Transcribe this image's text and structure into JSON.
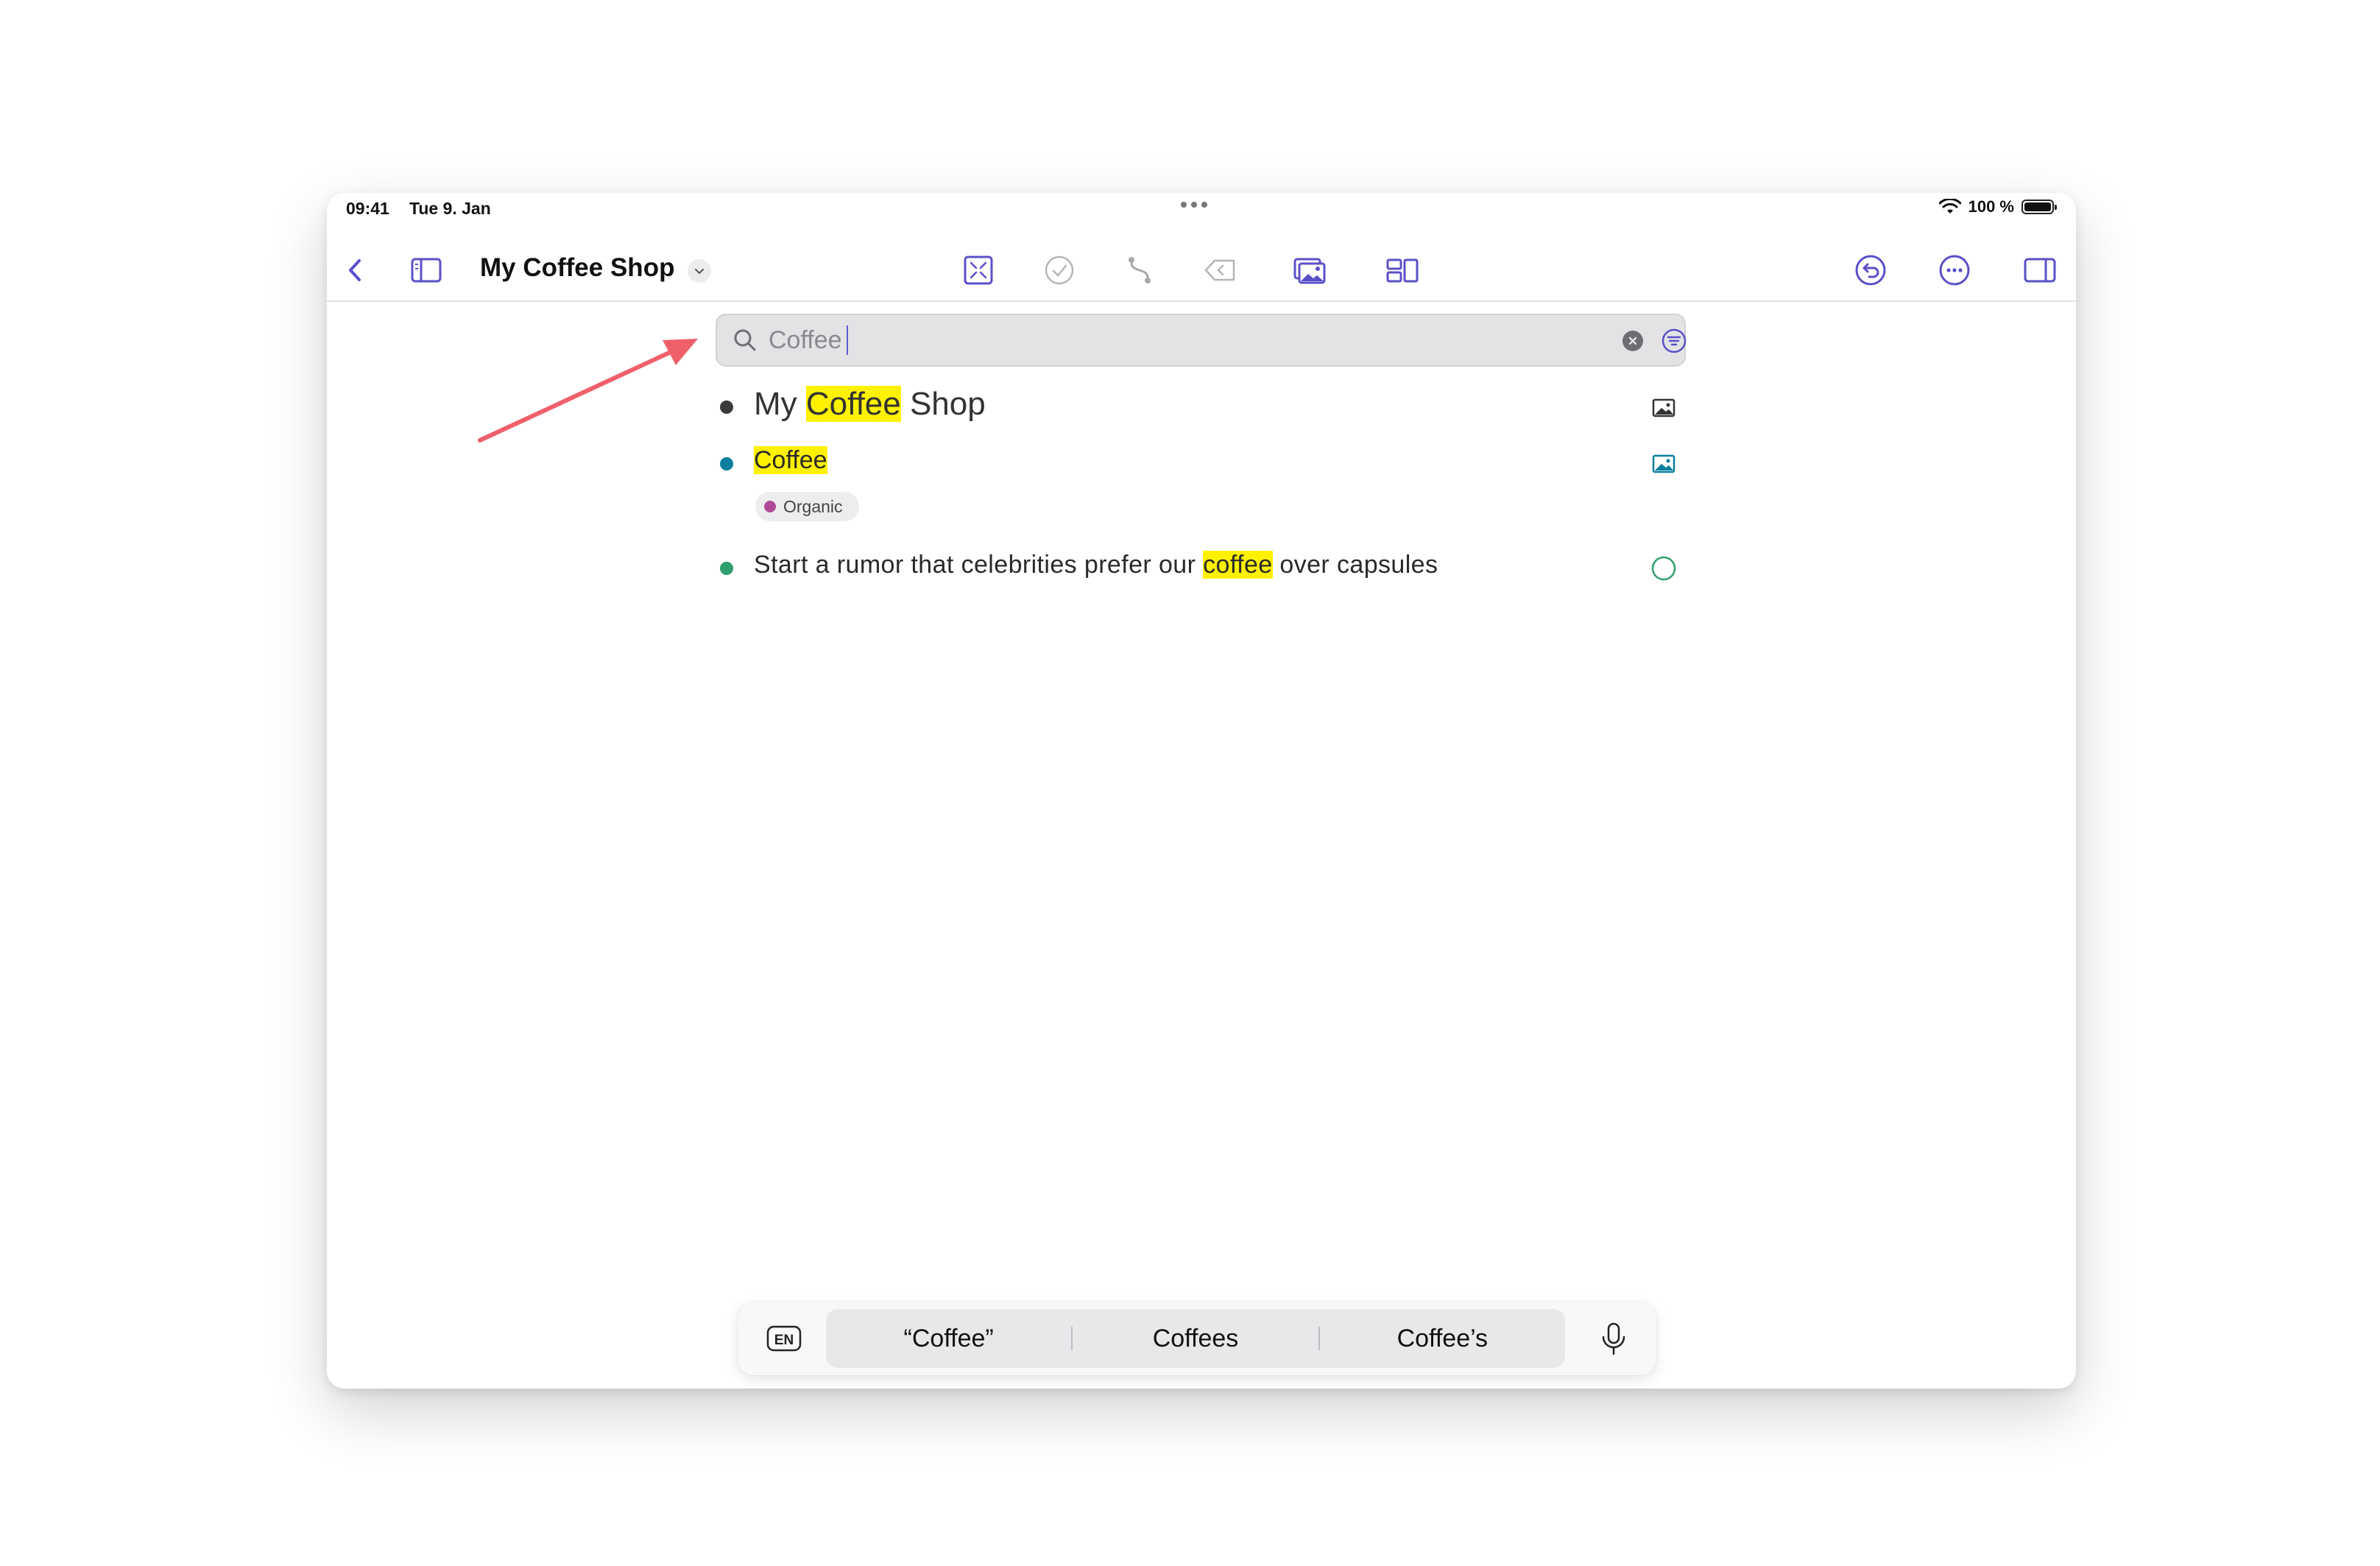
{
  "status_bar": {
    "time": "09:41",
    "date": "Tue 9. Jan",
    "battery": "100 %",
    "battery_level": 1.0
  },
  "toolbar": {
    "doc_title": "My Coffee Shop",
    "icons": [
      "back-chevron-icon",
      "sidebar-icon",
      "focus-icon",
      "checkmark-circle-icon",
      "connection-icon",
      "tag-icon",
      "media-icon",
      "layout-icon",
      "undo-icon",
      "more-icon",
      "inspector-icon"
    ]
  },
  "search": {
    "value": "Coffee",
    "placeholder": ""
  },
  "results": [
    {
      "before": "My ",
      "match": "Coffee",
      "after": " Shop",
      "bullet_color": "#3a3a3a"
    },
    {
      "before": "",
      "match": "Coffee",
      "after": "",
      "bullet_color": "#0a7f9f",
      "tag": "Organic",
      "tag_color": "#b04a98"
    },
    {
      "before": "Start a rumor that celebrities prefer our ",
      "match": "coffee",
      "after": " over capsules",
      "bullet_color": "#2f9e6e"
    }
  ],
  "keyboard": {
    "lang": "EN",
    "suggestions": [
      "“Coffee”",
      "Coffees",
      "Coffee’s"
    ]
  },
  "colors": {
    "accent": "#5a50c8",
    "highlight": "#fff200",
    "annotation_arrow": "#f0606a"
  }
}
